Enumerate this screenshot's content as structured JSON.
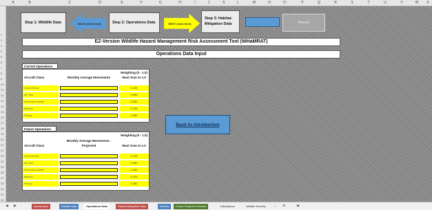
{
  "columns": [
    "A",
    "B",
    "C",
    "D",
    "E",
    "F",
    "G",
    "H",
    "I",
    "J",
    "K",
    "L",
    "M",
    "N",
    "O",
    "P",
    "Q",
    "R",
    "S",
    "T",
    "U",
    "V",
    "W",
    "X"
  ],
  "rows": [
    "1",
    "2",
    "3",
    "4",
    "5",
    "6",
    "7",
    "8",
    "9",
    "10",
    "11",
    "12",
    "13",
    "14",
    "15",
    "16",
    "17",
    "18",
    "19",
    "20",
    "21",
    "22",
    "23",
    "24",
    "25",
    "26",
    "27",
    "28",
    "29",
    "30",
    "31",
    "32",
    "33",
    "34",
    "35"
  ],
  "nav": {
    "step1": "Step 1: Wildlife Data",
    "back_label": "BACK (click here)",
    "step2": "Step 2: Operations Data",
    "next_label": "NEXT (click here)",
    "step3": "Step 3: Habitat-Mitigation Data",
    "results": "Results"
  },
  "title": "EZ-Version Wildlife Hazard Management Risk Assessment Tool (WHaMRAT)",
  "subtitle": "Operations Data Input",
  "current": {
    "label": "Current Operations",
    "col_class": "Aircraft Class",
    "col_movements": "Monthly Average Movements",
    "col_weight_1": "Weighting (0 - 1.0)",
    "col_weight_2": "Must Sum to 1.0",
    "rows": [
      {
        "cls": "Commercial",
        "wt": "0.125"
      },
      {
        "cls": "Air Taxi",
        "wt": "0.250"
      },
      {
        "cls": "General Aviation",
        "wt": "0.250"
      },
      {
        "cls": "Military",
        "wt": "0.125"
      },
      {
        "cls": "Rotary",
        "wt": "0.250"
      }
    ]
  },
  "future": {
    "label": "Future Operations",
    "col_class": "Aircraft Class",
    "col_movements_1": "Monthly Average Movements -",
    "col_movements_2": "Projected",
    "col_weight_1": "Weighting (0 - 1.0)",
    "col_weight_2": "Must Sum to 1.0",
    "rows": [
      {
        "cls": "Commercial",
        "wt": "0.125"
      },
      {
        "cls": "Air Taxi",
        "wt": "0.250"
      },
      {
        "cls": "General Aviation",
        "wt": "0.250"
      },
      {
        "cls": "Military",
        "wt": "0.125"
      },
      {
        "cls": "Rotary",
        "wt": "0.250"
      }
    ]
  },
  "back_to_intro": "Back to introduction",
  "tabs": [
    {
      "label": "Introduction",
      "color": "#c0504d"
    },
    {
      "label": "Wildlife Data",
      "color": "#4f81bd"
    },
    {
      "label": "Operations Data",
      "color": "#f2f2f2"
    },
    {
      "label": "Habitat-Mitigation Data",
      "color": "#c0504d"
    },
    {
      "label": "Results",
      "color": "#4f81bd"
    },
    {
      "label": "Future-Projected Results",
      "color": "#4e7b2f"
    },
    {
      "label": "Calculations",
      "color": "#f2f2f2"
    },
    {
      "label": "Wildlife Severity",
      "color": "#f2f2f2"
    }
  ],
  "tab_nav": {
    "prev": "◀",
    "next": "▶",
    "more": "...",
    "add": "⊕",
    "scroll": "◀"
  }
}
